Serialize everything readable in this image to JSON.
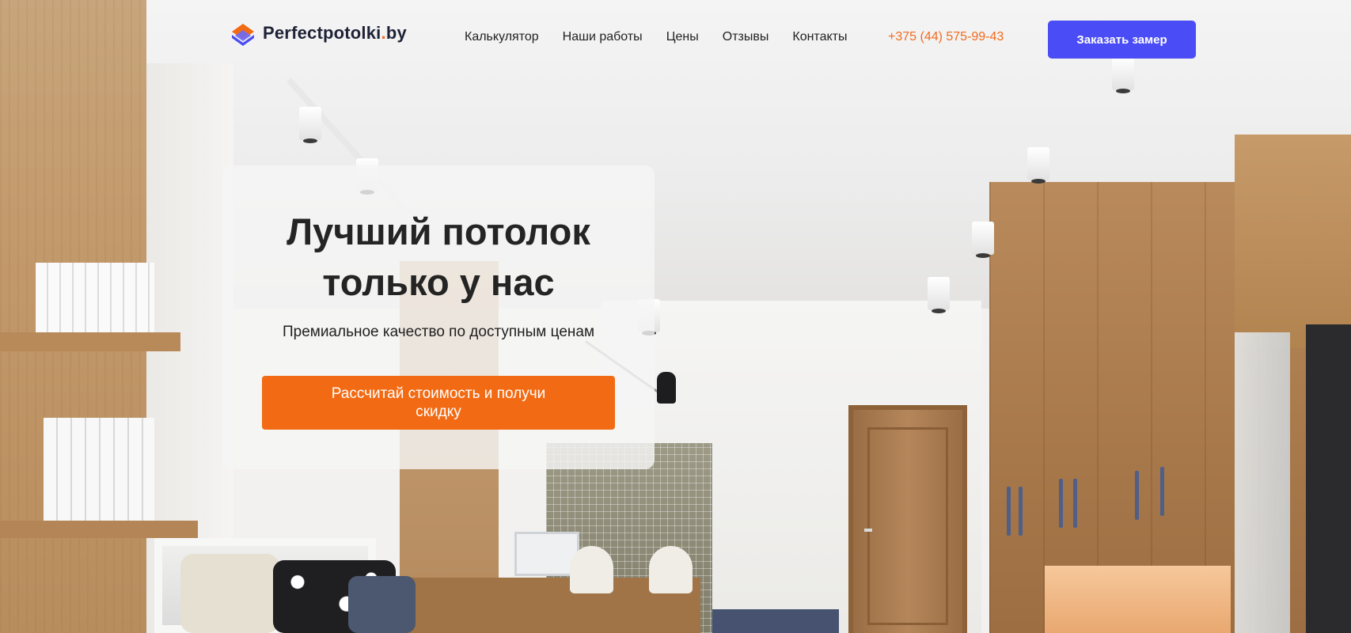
{
  "brand": {
    "name_main": "Perfectpotolki",
    "name_dot": ".",
    "name_tld": "by",
    "logo_icon": "diamond-layers-icon"
  },
  "nav": {
    "items": [
      {
        "label": "Калькулятор"
      },
      {
        "label": "Наши работы"
      },
      {
        "label": "Цены"
      },
      {
        "label": "Отзывы"
      },
      {
        "label": "Контакты"
      }
    ],
    "phone": "+375 (44) 575-99-43",
    "cta_label": "Заказать замер"
  },
  "hero": {
    "title_line1": "Лучший потолок",
    "title_line2": "только у нас",
    "subtitle": "Премиальное качество по доступным ценам",
    "button_label": "Рассчитай стоимость и получи скидку"
  },
  "colors": {
    "accent_orange": "#f26b14",
    "accent_blue": "#4a4cf5",
    "text_dark": "#242424"
  }
}
